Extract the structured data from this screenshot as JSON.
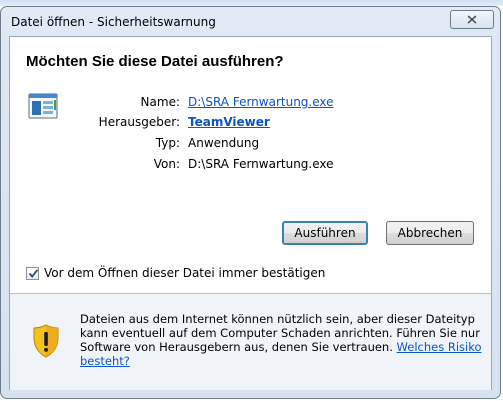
{
  "window": {
    "title": "Datei öffnen - Sicherheitswarnung"
  },
  "dialog": {
    "heading": "Möchten Sie diese Datei ausführen?",
    "file_icon": "executable-file-icon",
    "fields": {
      "name_label": "Name:",
      "name_value": "D:\\SRA Fernwartung.exe",
      "publisher_label": "Herausgeber:",
      "publisher_value": "TeamViewer",
      "type_label": "Typ:",
      "type_value": "Anwendung",
      "from_label": "Von:",
      "from_value": "D:\\SRA Fernwartung.exe"
    },
    "buttons": {
      "run": "Ausführen",
      "cancel": "Abbrechen"
    },
    "checkbox": {
      "label": "Vor dem Öffnen dieser Datei immer bestätigen",
      "checked": true
    },
    "warning": {
      "icon": "shield-warning-icon",
      "text": "Dateien aus dem Internet können nützlich sein, aber dieser Dateityp kann eventuell auf dem Computer Schaden anrichten. Führen Sie nur Software von Herausgebern aus, denen Sie vertrauen.",
      "link": "Welches Risiko besteht?"
    }
  },
  "colors": {
    "link": "#0a54c6",
    "shield_yellow": "#f3c21b",
    "shield_orange": "#e07a10"
  }
}
